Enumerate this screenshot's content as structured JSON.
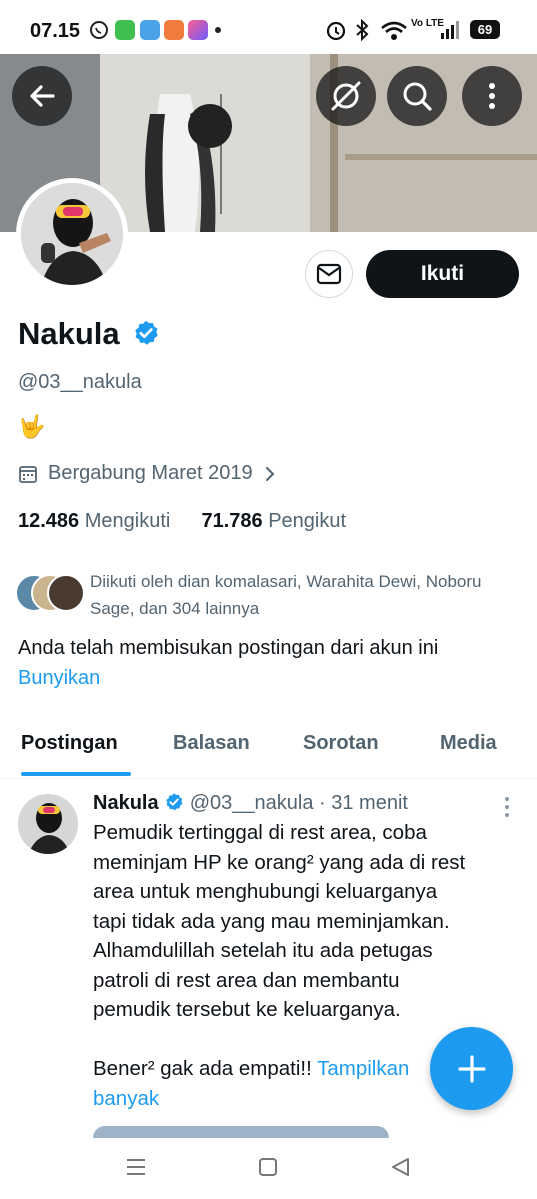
{
  "status_bar": {
    "time": "07.15",
    "battery": "69",
    "network": "Vo LTE"
  },
  "profile": {
    "name": "Nakula",
    "handle": "@03__nakula",
    "bio": "🤟",
    "joined": "Bergabung Maret 2019",
    "following_count": "12.486",
    "following_label": "Mengikuti",
    "followers_count": "71.786",
    "followers_label": "Pengikut",
    "followed_by": "Diikuti oleh dian komalasari, Warahita Dewi, Noboru Sage, dan 304 lainnya",
    "muted_notice": "Anda telah membisukan postingan dari akun ini",
    "unmute_link": "Bunyikan",
    "follow_button": "Ikuti"
  },
  "tabs": [
    {
      "label": "Postingan",
      "active": true
    },
    {
      "label": "Balasan",
      "active": false
    },
    {
      "label": "Sorotan",
      "active": false
    },
    {
      "label": "Media",
      "active": false
    }
  ],
  "post": {
    "author": "Nakula",
    "handle": "@03__nakula",
    "separator": "·",
    "time": "31 menit",
    "text_lines": [
      "Pemudik tertinggal di rest area, coba",
      "meminjam HP ke orang² yang ada di rest",
      "area untuk menghubungi keluarganya",
      "tapi tidak ada yang mau meminjamkan.",
      "Alhamdulillah setelah itu ada petugas",
      "patroli di rest area dan membantu",
      "pemudik tersebut ke keluarganya."
    ],
    "text_last": "Bener² gak ada empati!!",
    "show_more_1": "Tampilkan",
    "show_more_2": "banyak"
  },
  "colors": {
    "accent": "#1d9bf0",
    "text": "#0f1419",
    "secondary": "#536471"
  },
  "icons": [
    "back-arrow-icon",
    "hide-icon",
    "search-icon",
    "more-vertical-icon",
    "mail-icon",
    "verified-badge-icon",
    "calendar-icon",
    "chevron-right-icon",
    "plus-icon"
  ]
}
